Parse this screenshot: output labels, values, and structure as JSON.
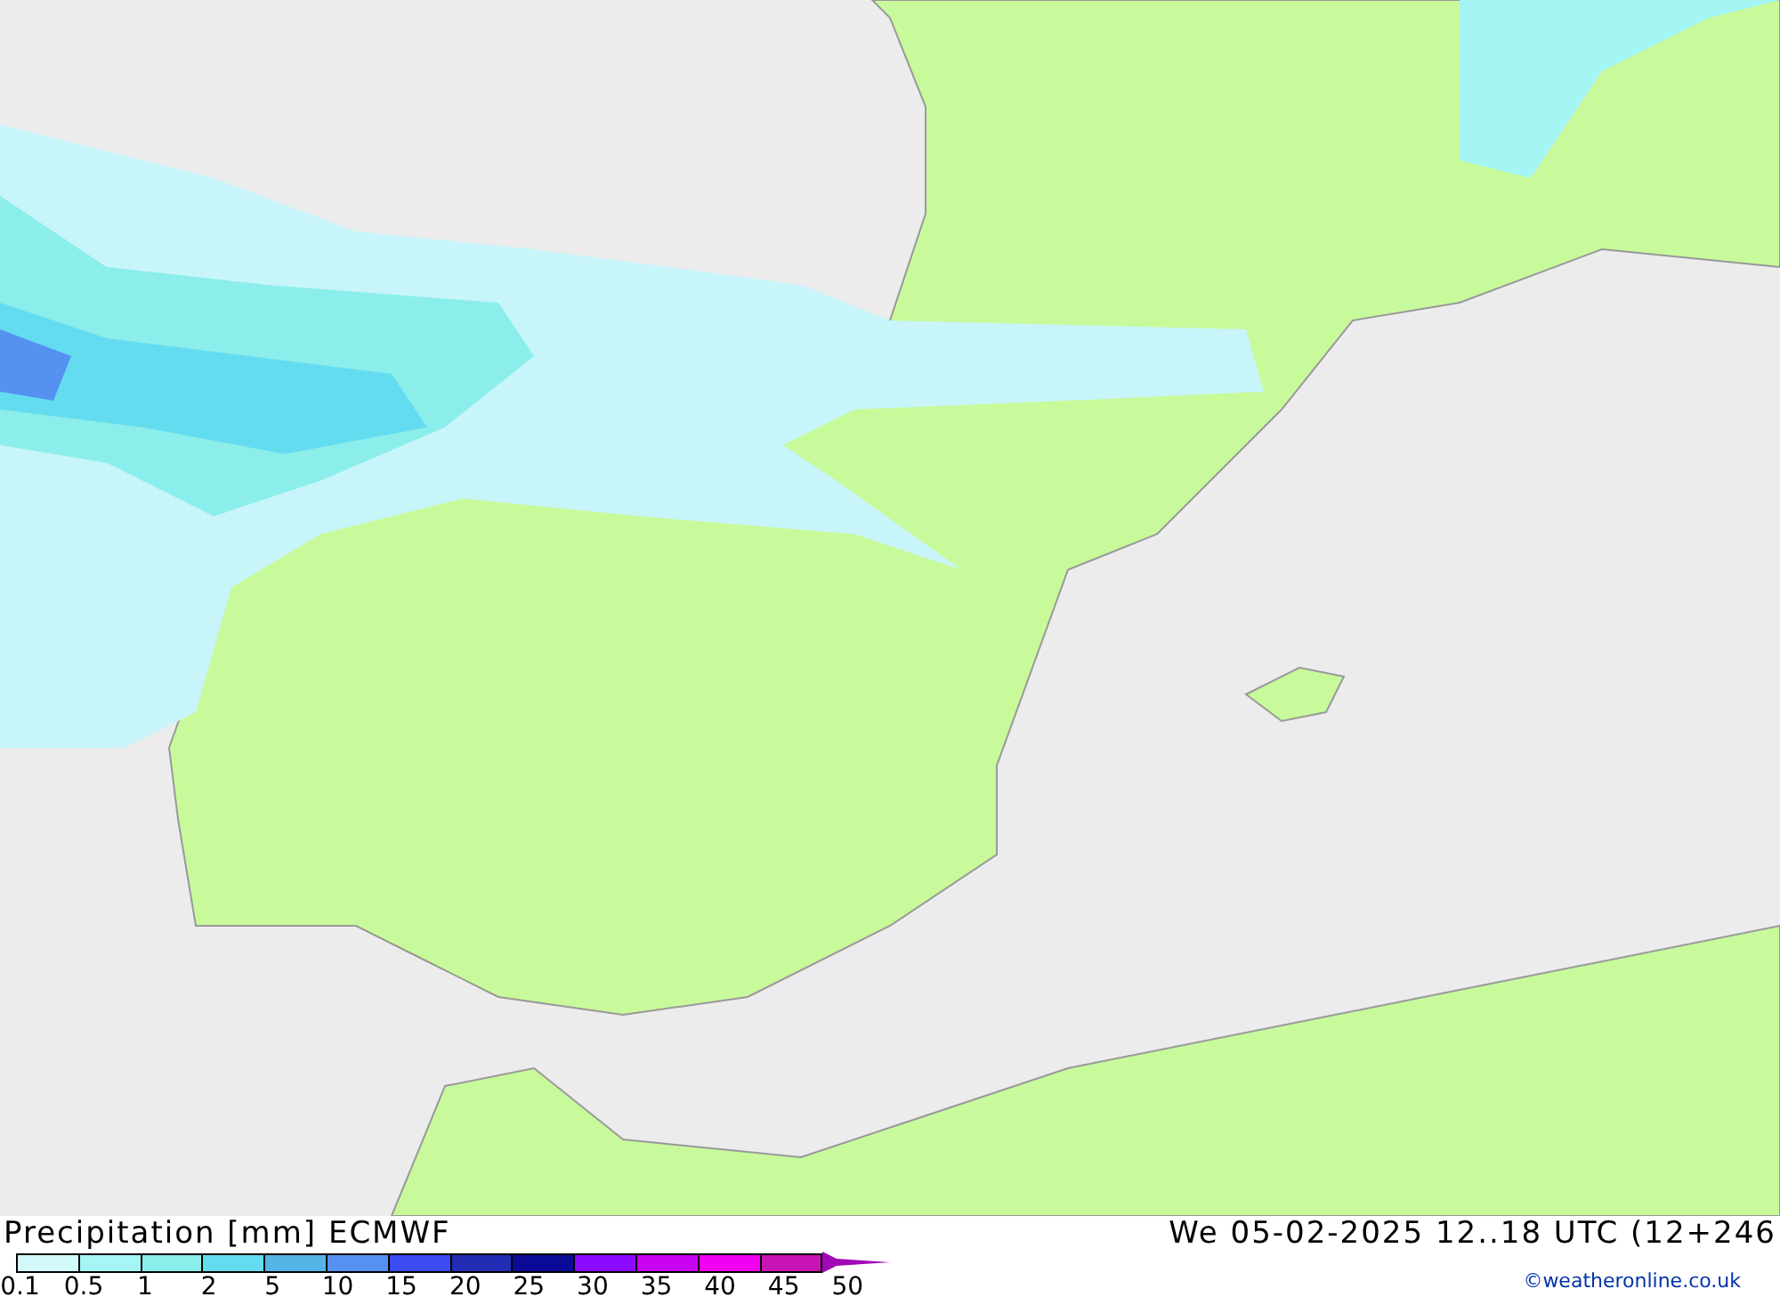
{
  "legend": {
    "title": "Precipitation [mm] ECMWF",
    "bins": [
      {
        "color": "#d2fafa"
      },
      {
        "color": "#a5f5f5"
      },
      {
        "color": "#8ceeea"
      },
      {
        "color": "#64dcf0"
      },
      {
        "color": "#55b4e6"
      },
      {
        "color": "#5591f0"
      },
      {
        "color": "#3c4bf0"
      },
      {
        "color": "#232db4"
      },
      {
        "color": "#0a0a96"
      },
      {
        "color": "#8c0aff"
      },
      {
        "color": "#c800f0"
      },
      {
        "color": "#f000f0"
      },
      {
        "color": "#c814b4"
      },
      {
        "kind": "overflow",
        "color": "#a00ab4"
      }
    ],
    "labels": [
      "0.1",
      "0.5",
      "1",
      "2",
      "5",
      "10",
      "15",
      "20",
      "25",
      "30",
      "35",
      "40",
      "45",
      "50"
    ]
  },
  "valid_time": "We 05-02-2025 12..18 UTC (12+246",
  "credit": "©weatheronline.co.uk"
}
